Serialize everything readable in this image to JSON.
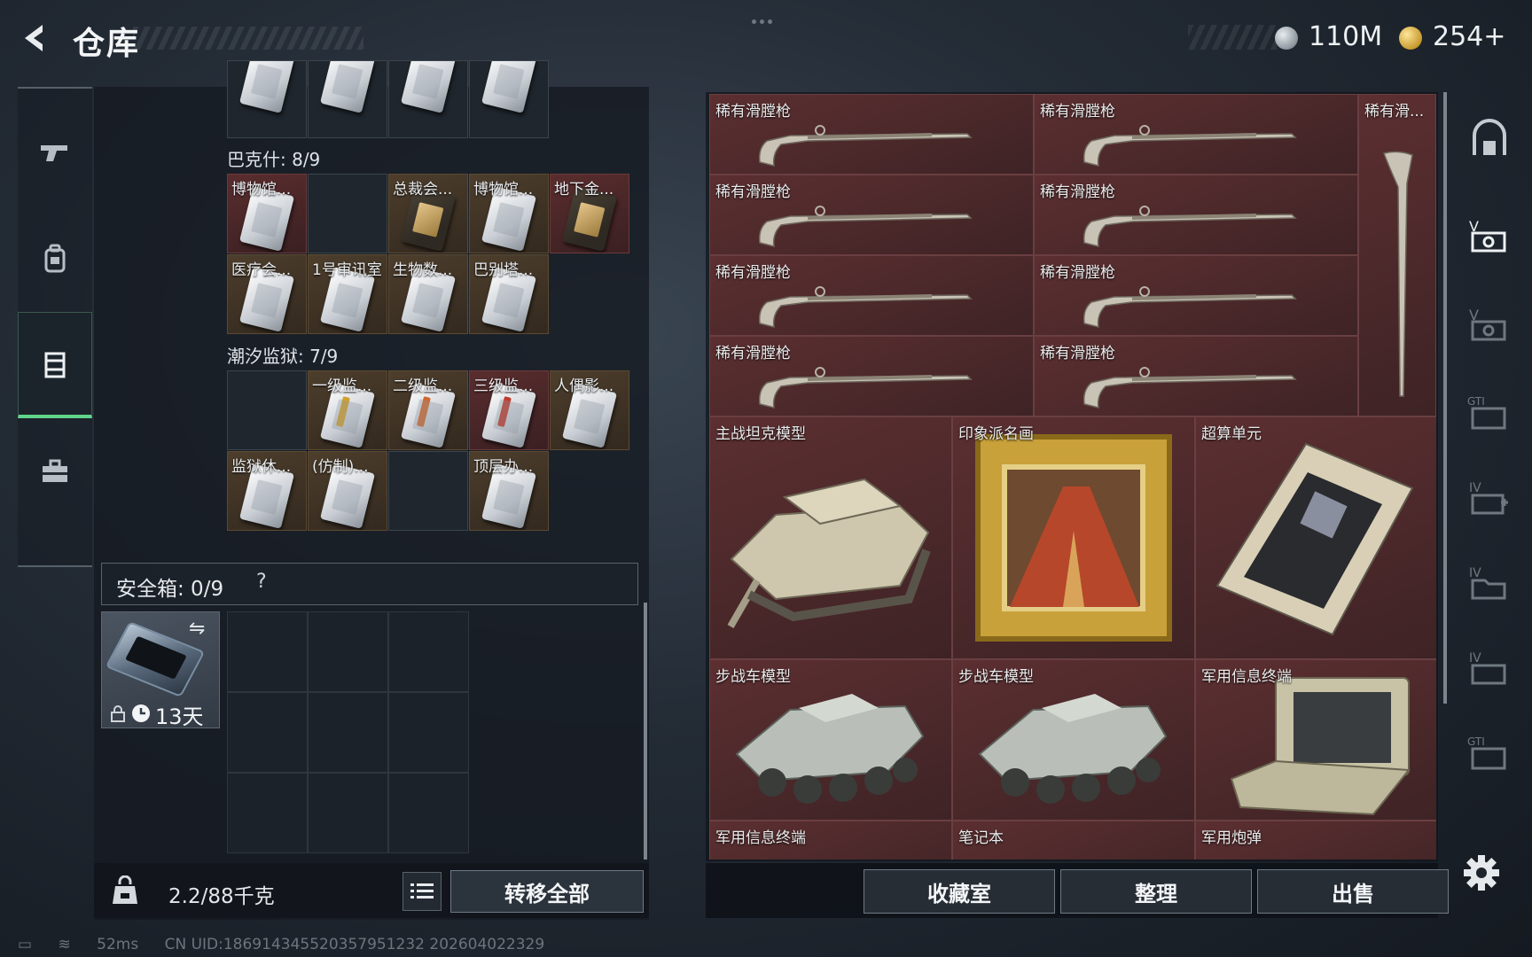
{
  "header": {
    "title": "仓库"
  },
  "currency": {
    "silver_amount": "110M",
    "gold_amount": "254+"
  },
  "left_nav": {
    "items": [
      "weapon",
      "backpack",
      "inventory",
      "toolbox"
    ],
    "active": "inventory"
  },
  "sections": {
    "bakesh": {
      "title": "巴克什: 8/9"
    },
    "tidal_prison": {
      "title": "潮汐监狱: 7/9"
    }
  },
  "top_row_cells": [
    "",
    "",
    "",
    ""
  ],
  "bakesh_cells": [
    {
      "label": "博物馆...",
      "style": "red"
    },
    {
      "label": "",
      "style": "empty"
    },
    {
      "label": "总裁会...",
      "style": "gold"
    },
    {
      "label": "博物馆...",
      "style": "gold"
    },
    {
      "label": "地下金...",
      "style": "red"
    },
    {
      "label": "医疗会...",
      "style": "gold"
    },
    {
      "label": "1号审讯室",
      "style": "gold"
    },
    {
      "label": "生物数...",
      "style": "gold"
    },
    {
      "label": "巴别塔...",
      "style": "gold"
    }
  ],
  "prison_cells": [
    {
      "label": "",
      "style": "empty"
    },
    {
      "label": "一级监...",
      "style": "gold"
    },
    {
      "label": "二级监...",
      "style": "gold"
    },
    {
      "label": "三级监...",
      "style": "red"
    },
    {
      "label": "人偶影...",
      "style": "gold"
    },
    {
      "label": "监狱休...",
      "style": "gold"
    },
    {
      "label": "(仿制)...",
      "style": "gold"
    },
    {
      "label": "",
      "style": "empty"
    },
    {
      "label": "顶层办...",
      "style": "gold"
    }
  ],
  "safe_box": {
    "label": "安全箱: 0/9",
    "help": "?",
    "timer": "13天"
  },
  "weight": {
    "text": "2.2/88千克"
  },
  "actions": {
    "transfer_all": "转移全部"
  },
  "stash": {
    "muskets": [
      "稀有滑膛枪",
      "稀有滑膛枪",
      "稀有滑膛枪",
      "稀有滑膛枪",
      "稀有滑膛枪",
      "稀有滑膛枪",
      "稀有滑膛枪",
      "稀有滑膛枪"
    ],
    "vertical_musket": "稀有滑...",
    "row_big": [
      "主战坦克模型",
      "印象派名画",
      "超算单元"
    ],
    "row_mid": [
      "步战车模型",
      "步战车模型",
      "军用信息终端"
    ],
    "row_bottom": [
      "军用信息终端",
      "笔记本",
      "军用炮弹"
    ]
  },
  "stash_actions": {
    "collection": "收藏室",
    "sort": "整理",
    "sell": "出售"
  },
  "status": {
    "ping": "52ms",
    "uid": "CN UID:186914345520357951232 202604022329"
  },
  "colors": {
    "accent_green": "#5fd48a",
    "item_red": "#5c2f31",
    "item_gold": "#4d3e2c"
  }
}
